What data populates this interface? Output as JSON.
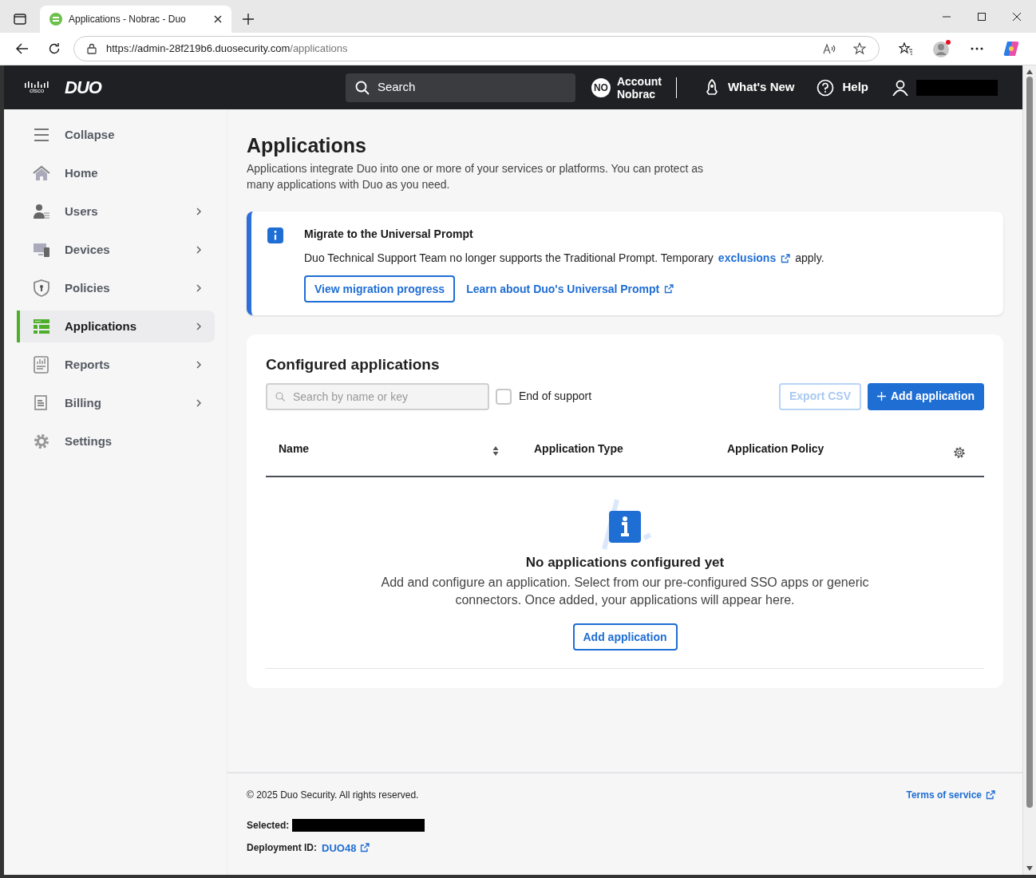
{
  "browser": {
    "tab_title": "Applications - Nobrac - Duo",
    "address": {
      "origin": "https://admin-28f219b6.duosecurity.com",
      "path": "/applications"
    }
  },
  "header": {
    "cisco_logo": "cisco",
    "duo_logo": "DUO",
    "search": {
      "label": "Search"
    },
    "account": {
      "badge": "NO",
      "label_line1": "Account",
      "label_line2": "Nobrac"
    },
    "whats_new": "What's New",
    "help": "Help",
    "user_redacted": true
  },
  "sidebar": {
    "items": [
      {
        "kind": "menu",
        "label": "Collapse",
        "has_submenu": false,
        "selected": false
      },
      {
        "kind": "home",
        "label": "Home",
        "has_submenu": false,
        "selected": false
      },
      {
        "kind": "users",
        "label": "Users",
        "has_submenu": true,
        "selected": false
      },
      {
        "kind": "devices",
        "label": "Devices",
        "has_submenu": true,
        "selected": false
      },
      {
        "kind": "policies",
        "label": "Policies",
        "has_submenu": true,
        "selected": false
      },
      {
        "kind": "applications",
        "label": "Applications",
        "has_submenu": true,
        "selected": true
      },
      {
        "kind": "reports",
        "label": "Reports",
        "has_submenu": true,
        "selected": false
      },
      {
        "kind": "billing",
        "label": "Billing",
        "has_submenu": true,
        "selected": false
      },
      {
        "kind": "settings",
        "label": "Settings",
        "has_submenu": false,
        "selected": false
      }
    ]
  },
  "page": {
    "title": "Applications",
    "description": "Applications integrate Duo into one or more of your services or platforms. You can protect as many applications with Duo as you need."
  },
  "notice": {
    "title": "Migrate to the Universal Prompt",
    "text_before": "Duo Technical Support Team no longer supports the Traditional Prompt. Temporary",
    "link": "exclusions",
    "text_after": "apply.",
    "button": "View migration progress",
    "learn_link": "Learn about Duo's Universal Prompt"
  },
  "configured": {
    "title": "Configured applications",
    "search": {
      "placeholder": "Search by name or key"
    },
    "end_of_support": {
      "label": "End of support",
      "checked": false
    },
    "export_button": {
      "label": "Export CSV",
      "disabled": true
    },
    "add_button": "Add application",
    "table": {
      "columns": [
        "Name",
        "Application Type",
        "Application Policy"
      ]
    },
    "empty": {
      "title": "No applications configured yet",
      "text": "Add and configure an application. Select from our pre-configured SSO apps or generic connectors. Once added, your applications will appear here.",
      "button": "Add application"
    }
  },
  "footer": {
    "copyright": "© 2025 Duo Security. All rights reserved.",
    "terms": "Terms of service",
    "selected_label": "Selected:",
    "selected_redacted": true,
    "deployment_label": "Deployment ID:",
    "deployment_id": "DUO48"
  }
}
